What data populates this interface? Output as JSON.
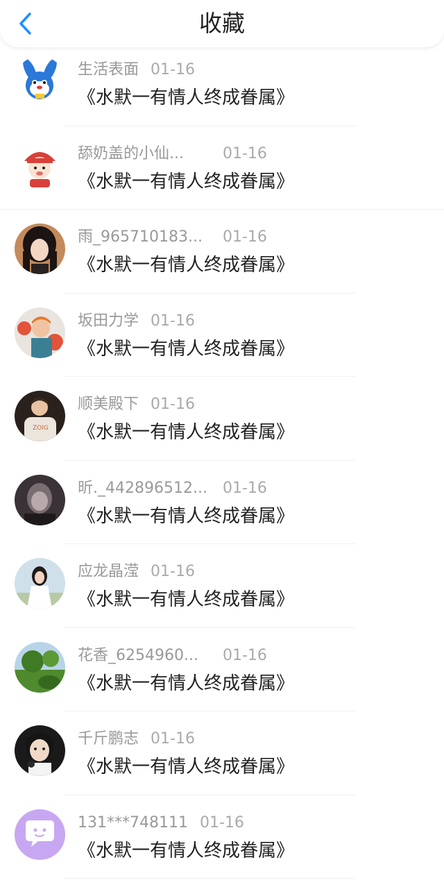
{
  "header": {
    "title": "收藏",
    "back_icon": "chevron-left-icon",
    "accent_color": "#1e90ff"
  },
  "favorites": [
    {
      "nickname": "生活表面",
      "date": "01-16",
      "content": "《水默一有情人终成眷属》"
    },
    {
      "nickname": "舔奶盖的小仙...",
      "date": "01-16",
      "content": "《水默一有情人终成眷属》"
    },
    {
      "nickname": "雨_965710183...",
      "date": "01-16",
      "content": "《水默一有情人终成眷属》"
    },
    {
      "nickname": "坂田力学",
      "date": "01-16",
      "content": "《水默一有情人终成眷属》"
    },
    {
      "nickname": "顺美殿下",
      "date": "01-16",
      "content": "《水默一有情人终成眷属》"
    },
    {
      "nickname": "昕._442896512...",
      "date": "01-16",
      "content": "《水默一有情人终成眷属》"
    },
    {
      "nickname": "应龙晶滢",
      "date": "01-16",
      "content": "《水默一有情人终成眷属》"
    },
    {
      "nickname": "花香_6254960...",
      "date": "01-16",
      "content": "《水默一有情人终成眷属》"
    },
    {
      "nickname": "千斤鹏志",
      "date": "01-16",
      "content": "《水默一有情人终成眷属》"
    },
    {
      "nickname": "131***748111",
      "date": "01-16",
      "content": "《水默一有情人终成眷属》"
    }
  ]
}
